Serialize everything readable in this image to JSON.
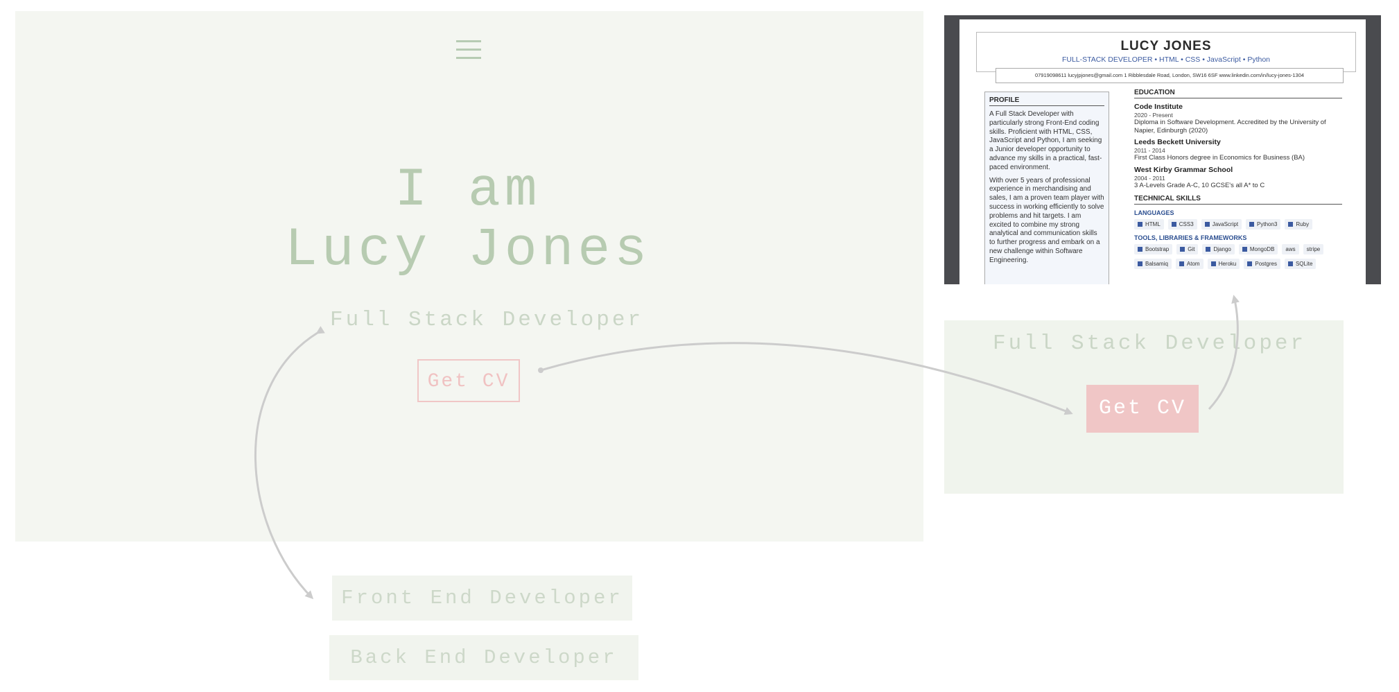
{
  "hero": {
    "menu_icon": "hamburger-menu-icon",
    "title_line1": "I am",
    "title_line2": "Lucy Jones",
    "role": "Full Stack Developer",
    "cv_button": "Get CV"
  },
  "cv": {
    "name": "LUCY JONES",
    "subtitle": "FULL-STACK DEVELOPER • HTML • CSS • JavaScript • Python",
    "contact": "07919098611   lucyjpjones@gmail.com   1 Ribblesdale Road, London, SW16 6SF   www.linkedin.com/in/lucy-jones-1304",
    "profile_heading": "PROFILE",
    "profile_p1": "A Full Stack Developer with particularly strong Front-End coding skills. Proficient with HTML, CSS, JavaScript and Python, I am seeking a Junior developer opportunity to advance my skills in a practical, fast-paced environment.",
    "profile_p2": "With over 5 years of professional experience in merchandising and sales, I am a proven team player with success in working efficiently to solve problems and hit targets. I am excited to combine my strong analytical and communication skills to further progress and embark on a new challenge within Software Engineering.",
    "education_heading": "EDUCATION",
    "edu1_school": "Code Institute",
    "edu1_dates": "2020 - Present",
    "edu1_detail": "Diploma in Software Development. Accredited by the University of Napier, Edinburgh (2020)",
    "edu2_school": "Leeds Beckett University",
    "edu2_dates": "2011 - 2014",
    "edu2_detail": "First Class Honors degree in Economics for Business (BA)",
    "edu3_school": "West Kirby Grammar School",
    "edu3_dates": "2004 - 2011",
    "edu3_detail": "3 A-Levels Grade A-C, 10 GCSE's all A* to C",
    "skills_heading": "TECHNICAL SKILLS",
    "languages_heading": "LANGUAGES",
    "languages": [
      "HTML",
      "CSS3",
      "JavaScript",
      "Python3",
      "Ruby"
    ],
    "tools_heading": "TOOLS, LIBRARIES & FRAMEWORKS",
    "tools": [
      "Bootstrap",
      "Git",
      "Django",
      "MongoDB",
      "aws",
      "stripe",
      "Balsamiq",
      "Atom",
      "Heroku",
      "Postgres",
      "SQLite"
    ]
  },
  "card": {
    "role": "Full Stack Developer",
    "cv_button": "Get CV"
  },
  "roles": {
    "front": "Front End Developer",
    "back": "Back End Developer"
  }
}
